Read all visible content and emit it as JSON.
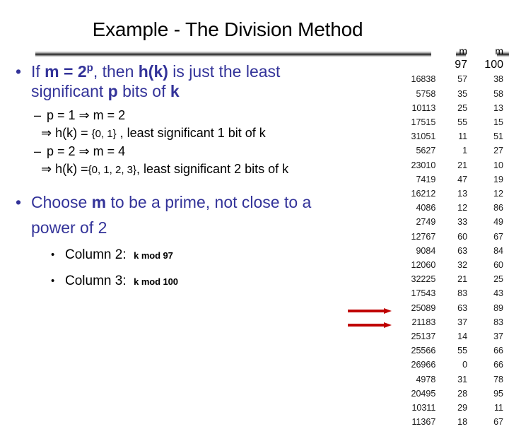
{
  "slide": {
    "title": "Example - The Division Method"
  },
  "bullets": {
    "b1_pre": "If ",
    "b1_m": "m",
    "b1_eq": " = ",
    "b1_two": "2",
    "b1_p_sup": "p",
    "b1_comma_then": ", then ",
    "b1_hk": "h(k)",
    "b1_rest": " is just the least",
    "b1_line2_a": "significant ",
    "b1_line2_p": "p",
    "b1_line2_b": " bits of ",
    "b1_line2_k": "k",
    "sub1_dash": "–",
    "sub1_text": "p = 1  m = 2",
    "sub1_arrow": "⇒",
    "sub1_a": "p = 1 ",
    "sub1_b": " m = 2",
    "imp1_arrow": "⇒",
    "imp1_a": " h(k) = ",
    "imp1_set": "{0, 1}",
    "imp1_b": " , least significant 1 bit of k",
    "sub2_dash": "–",
    "sub2_a": "p = 2 ",
    "sub2_arrow": "⇒",
    "sub2_b": " m = 4",
    "imp2_arrow": "⇒",
    "imp2_a": " h(k) =",
    "imp2_set": "{0, 1, 2, 3}",
    "imp2_b": ", least significant 2 bits of k",
    "b2_bullet": "•",
    "b2_a": "Choose ",
    "b2_m": "m",
    "b2_b": " to be a prime, not close to a",
    "b2_line2": "power of 2",
    "b3_bullet": "•",
    "b3_label": "Column 2:",
    "b3_value": "k mod 97",
    "b4_bullet": "•",
    "b4_label": "Column 3:",
    "b4_value": "k mod 100",
    "bullet_glyph": "•"
  },
  "table": {
    "header_top": [
      "m",
      "m"
    ],
    "header_bottom": [
      "97",
      "100"
    ],
    "rows": [
      [
        "16838",
        "57",
        "38"
      ],
      [
        "5758",
        "35",
        "58"
      ],
      [
        "10113",
        "25",
        "13"
      ],
      [
        "17515",
        "55",
        "15"
      ],
      [
        "31051",
        "11",
        "51"
      ],
      [
        "5627",
        "1",
        "27"
      ],
      [
        "23010",
        "21",
        "10"
      ],
      [
        "7419",
        "47",
        "19"
      ],
      [
        "16212",
        "13",
        "12"
      ],
      [
        "4086",
        "12",
        "86"
      ],
      [
        "2749",
        "33",
        "49"
      ],
      [
        "12767",
        "60",
        "67"
      ],
      [
        "9084",
        "63",
        "84"
      ],
      [
        "12060",
        "32",
        "60"
      ],
      [
        "32225",
        "21",
        "25"
      ],
      [
        "17543",
        "83",
        "43"
      ],
      [
        "25089",
        "63",
        "89"
      ],
      [
        "21183",
        "37",
        "83"
      ],
      [
        "25137",
        "14",
        "37"
      ],
      [
        "25566",
        "55",
        "66"
      ],
      [
        "26966",
        "0",
        "66"
      ],
      [
        "4978",
        "31",
        "78"
      ],
      [
        "20495",
        "28",
        "95"
      ],
      [
        "10311",
        "29",
        "11"
      ],
      [
        "11367",
        "18",
        "67"
      ]
    ]
  },
  "colors": {
    "heading_text": "#000000",
    "bullet_blue": "#333399",
    "arrow_red": "#c00000",
    "table_text": "#1a1a1a"
  }
}
